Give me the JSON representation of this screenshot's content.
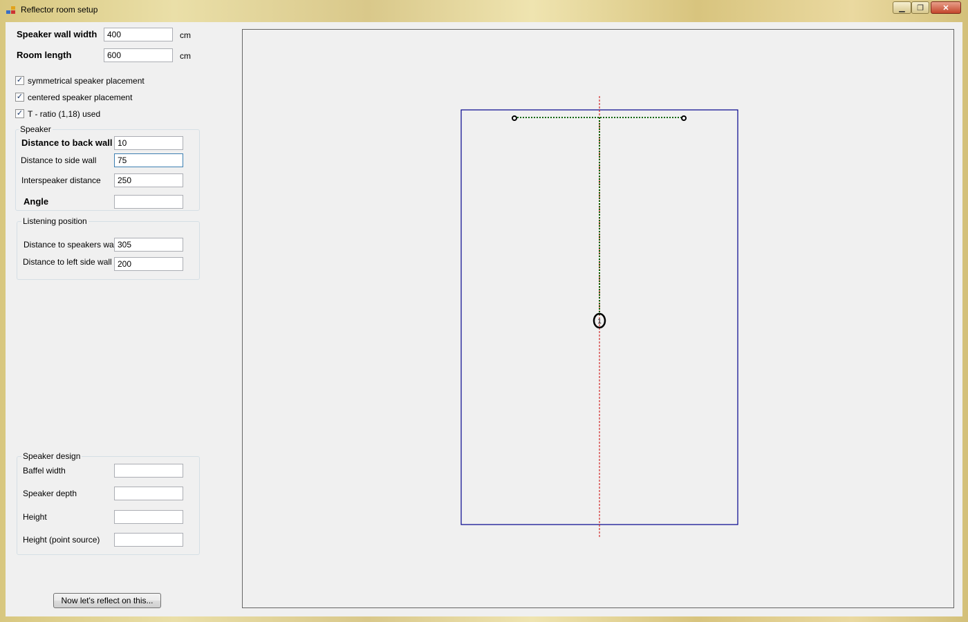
{
  "window": {
    "title": "Reflector room setup"
  },
  "room": {
    "wall_width_label": "Speaker wall width",
    "wall_width_value": "400",
    "wall_width_unit": "cm",
    "length_label": "Room length",
    "length_value": "600",
    "length_unit": "cm"
  },
  "options": [
    {
      "label": "symmetrical speaker placement",
      "checked": true
    },
    {
      "label": "centered speaker placement",
      "checked": true
    },
    {
      "label": "T - ratio (1,18) used",
      "checked": true
    }
  ],
  "speaker": {
    "group_title": "Speaker",
    "back_wall_label": "Distance to back wall",
    "back_wall_value": "10",
    "side_wall_label": "Distance to side wall",
    "side_wall_value": "75",
    "interspeaker_label": "Interspeaker distance",
    "interspeaker_value": "250",
    "angle_label": "Angle",
    "angle_value": ""
  },
  "listening": {
    "group_title": "Listening position",
    "speakers_wall_label": "Distance to speakers wall",
    "speakers_wall_value": "305",
    "left_wall_label": "Distance to left side wall",
    "left_wall_value": "200"
  },
  "design": {
    "group_title": "Speaker design",
    "baffle_label": "Baffel width",
    "baffle_value": "",
    "depth_label": "Speaker depth",
    "depth_value": "",
    "height_label": "Height",
    "height_value": "",
    "point_label": "Height (point source)",
    "point_value": ""
  },
  "actions": {
    "reflect_label": "Now let's reflect on this..."
  },
  "drawing": {
    "listener_marker": "1",
    "colors": {
      "room": "#00008b",
      "axis": "#cc0000",
      "speaker_line": "#006400"
    }
  }
}
